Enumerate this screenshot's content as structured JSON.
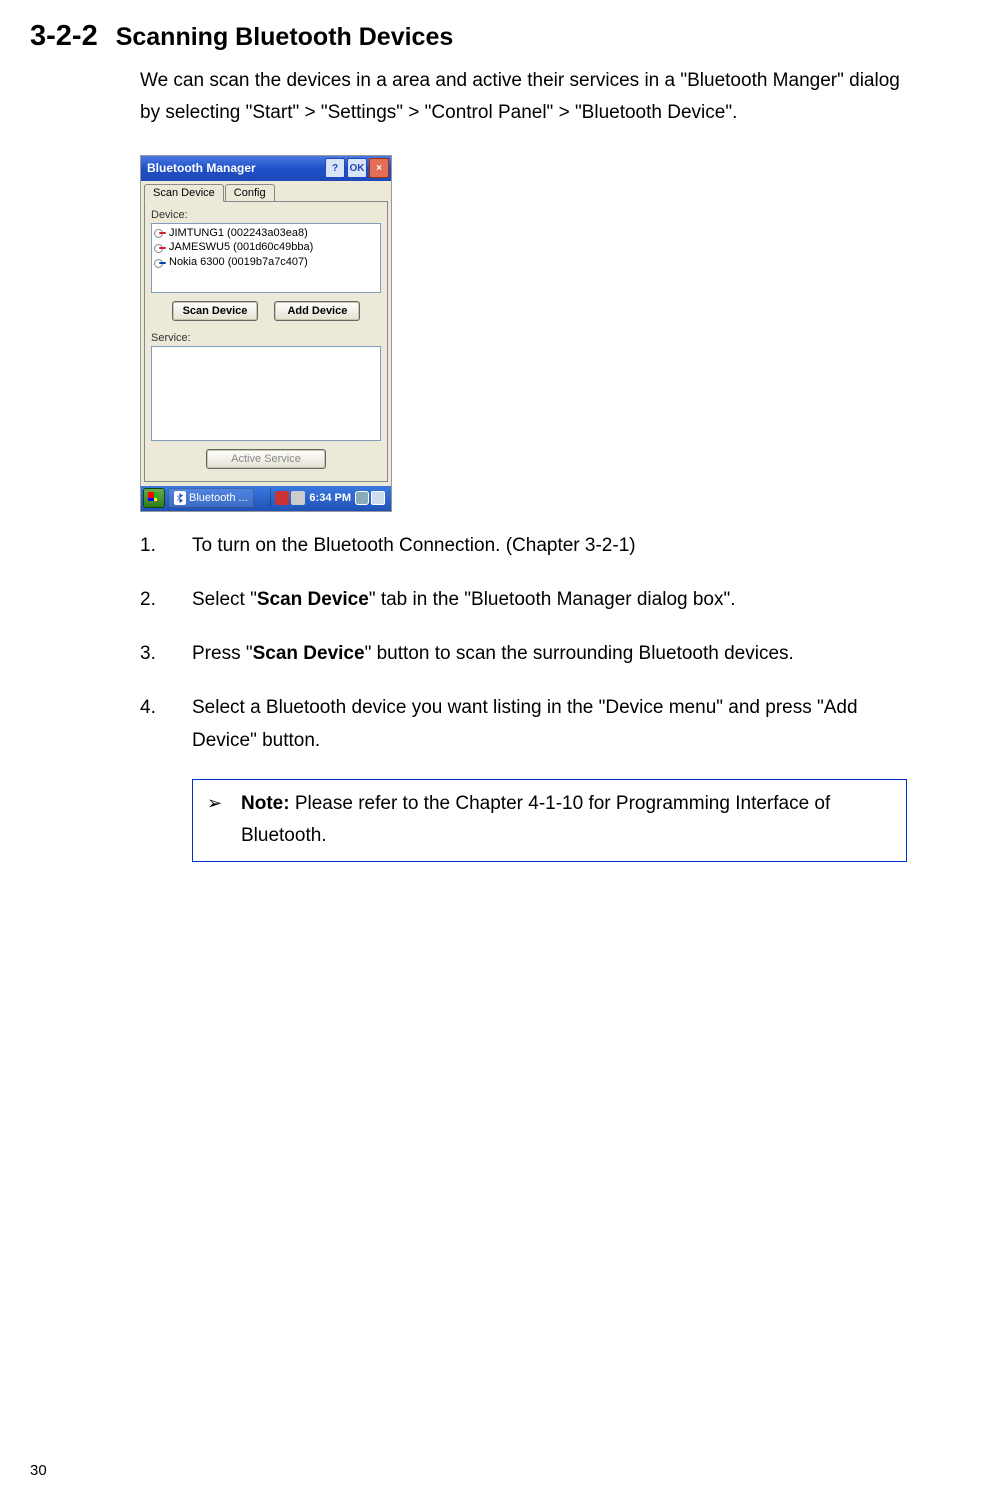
{
  "section": {
    "number": "3-2-2",
    "title": "Scanning Bluetooth Devices"
  },
  "intro": "We can scan the devices in a area and active their services in a \"Bluetooth Manger\" dialog by selecting \"Start\" > \"Settings\" > \"Control Panel\" > \"Bluetooth Device\".",
  "screenshot": {
    "title": "Bluetooth Manager",
    "titlebar": {
      "help": "?",
      "ok": "OK",
      "close": "×"
    },
    "tabs": {
      "scan": "Scan Device",
      "config": "Config"
    },
    "labels": {
      "device": "Device:",
      "service": "Service:"
    },
    "devices": [
      "JIMTUNG1 (002243a03ea8)",
      "JAMESWU5 (001d60c49bba)",
      "Nokia 6300 (0019b7a7c407)"
    ],
    "buttons": {
      "scan": "Scan Device",
      "add": "Add Device",
      "active": "Active Service"
    },
    "taskbar": {
      "item": "Bluetooth ...",
      "time": "6:34 PM"
    }
  },
  "steps": [
    {
      "num": "1.",
      "pre": "To turn on the Bluetooth Connection. (Chapter 3-2-1)"
    },
    {
      "num": "2.",
      "pre": "Select \"",
      "bold": "Scan Device",
      "post": "\" tab in the \"Bluetooth Manager dialog box\"."
    },
    {
      "num": "3.",
      "pre": "Press \"",
      "bold": "Scan Device",
      "post": "\" button to scan the surrounding Bluetooth devices."
    },
    {
      "num": "4.",
      "pre": "Select a Bluetooth device you want listing in the \"Device menu\" and press \"Add Device\" button."
    }
  ],
  "note": {
    "arrow": "➢",
    "bold": "Note:",
    "text": " Please refer to the Chapter 4-1-10 for Programming Interface of Bluetooth."
  },
  "page": "30"
}
